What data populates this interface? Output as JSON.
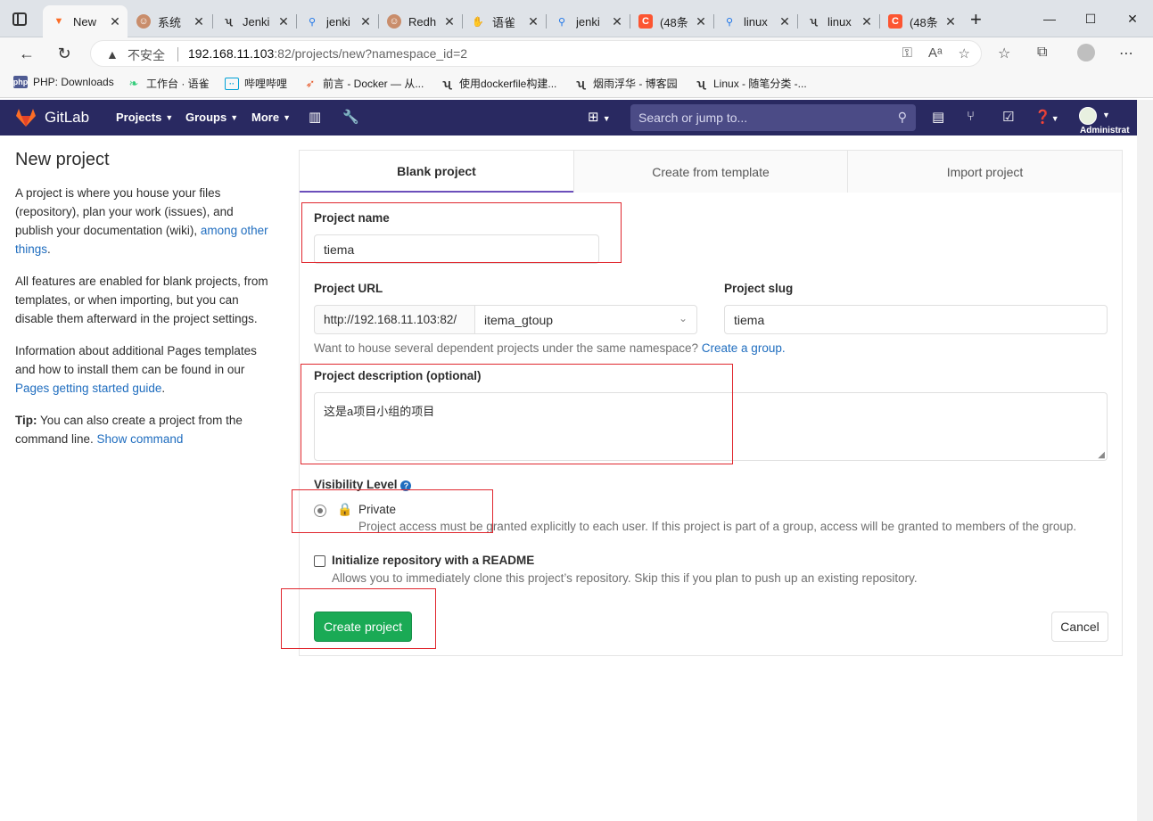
{
  "browser": {
    "tabs": [
      {
        "title": "New",
        "icon": "gitlab-icon",
        "active": true
      },
      {
        "title": "系统",
        "icon": "avatar-icon"
      },
      {
        "title": "Jenki",
        "icon": "yuque-icon"
      },
      {
        "title": "jenki",
        "icon": "search-icon"
      },
      {
        "title": "Redh",
        "icon": "avatar-icon"
      },
      {
        "title": "语雀",
        "icon": "baidu-icon"
      },
      {
        "title": "jenki",
        "icon": "search-icon"
      },
      {
        "title": "(48条",
        "icon": "csdn-icon"
      },
      {
        "title": "linux",
        "icon": "search-icon"
      },
      {
        "title": "linux",
        "icon": "yuque-icon"
      },
      {
        "title": "(48条",
        "icon": "csdn-icon"
      }
    ],
    "new_tab": "+",
    "security_label": "不安全",
    "url_host": "192.168.11.103",
    "url_path": ":82/projects/new?namespace_id=2",
    "bookmarks": [
      "PHP: Downloads",
      "工作台 · 语雀",
      "哔哩哔哩",
      "前言 - Docker — 从...",
      "使用dockerfile构建...",
      "烟雨浮华 - 博客园",
      "Linux - 随笔分类 -..."
    ]
  },
  "gitlab_nav": {
    "brand": "GitLab",
    "menus": [
      "Projects",
      "Groups",
      "More"
    ],
    "search_placeholder": "Search or jump to...",
    "user_label": "Administrat"
  },
  "sidebar": {
    "title": "New project",
    "para1_text": "A project is where you house your files (repository), plan your work (issues), and publish your documentation (wiki), ",
    "para1_link": "among other things",
    "para1_end": ".",
    "para2": "All features are enabled for blank projects, from templates, or when importing, but you can disable them afterward in the project settings.",
    "para3_text": "Information about additional Pages templates and how to install them can be found in our ",
    "para3_link": "Pages getting started guide",
    "para3_end": ".",
    "tip_label": "Tip:",
    "tip_text": " You can also create a project from the command line. ",
    "tip_link": "Show command"
  },
  "form": {
    "tabs": [
      "Blank project",
      "Create from template",
      "Import project"
    ],
    "project_name_label": "Project name",
    "project_name_value": "tiema",
    "project_url_label": "Project URL",
    "url_prefix": "http://192.168.11.103:82/",
    "namespace_value": "itema_gtoup",
    "slug_label": "Project slug",
    "slug_value": "tiema",
    "group_help": "Want to house several dependent projects under the same namespace? ",
    "group_help_link": "Create a group.",
    "description_label": "Project description (optional)",
    "description_value": "这是a项目小组的项目",
    "visibility_label": "Visibility Level",
    "private_label": "Private",
    "private_help": "Project access must be granted explicitly to each user. If this project is part of a group, access will be granted to members of the group.",
    "readme_label": "Initialize repository with a README",
    "readme_help": "Allows you to immediately clone this project’s repository. Skip this if you plan to push up an existing repository.",
    "create_button": "Create project",
    "cancel_button": "Cancel"
  },
  "colors": {
    "gitlab_nav_bg": "#292961",
    "primary_green": "#1aaa55",
    "link_blue": "#1f6dbf",
    "annotation_red": "#e0272e",
    "tab_underline": "#6b4fbb"
  }
}
